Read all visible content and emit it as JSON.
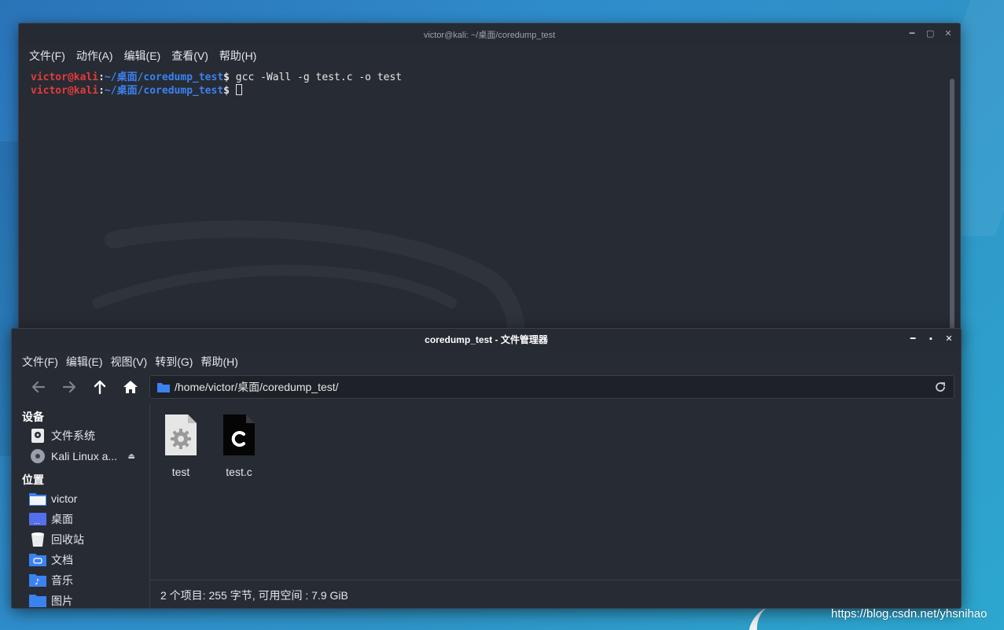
{
  "terminal": {
    "title": "victor@kali: ~/桌面/coredump_test",
    "menu": [
      "文件(F)",
      "动作(A)",
      "编辑(E)",
      "查看(V)",
      "帮助(H)"
    ],
    "lines": [
      {
        "user": "victor@kali",
        "sep": ":",
        "path": "~/桌面/coredump_test",
        "dollar": "$",
        "cmd": " gcc -Wall -g test.c -o test"
      },
      {
        "user": "victor@kali",
        "sep": ":",
        "path": "~/桌面/coredump_test",
        "dollar": "$",
        "cmd": " "
      }
    ]
  },
  "file_manager": {
    "title": "coredump_test - 文件管理器",
    "menu": [
      "文件(F)",
      "编辑(E)",
      "视图(V)",
      "转到(G)",
      "帮助(H)"
    ],
    "address": "/home/victor/桌面/coredump_test/",
    "sidebar": {
      "devices_header": "设备",
      "devices": [
        {
          "label": "文件系统",
          "icon": "drive-icon"
        },
        {
          "label": "Kali Linux a...",
          "icon": "disc-icon"
        }
      ],
      "places_header": "位置",
      "places": [
        {
          "label": "victor",
          "icon": "home-folder-icon"
        },
        {
          "label": "桌面",
          "icon": "desktop-folder-icon"
        },
        {
          "label": "回收站",
          "icon": "trash-icon"
        },
        {
          "label": "文档",
          "icon": "documents-folder-icon"
        },
        {
          "label": "音乐",
          "icon": "music-folder-icon"
        },
        {
          "label": "图片",
          "icon": "pictures-folder-icon"
        }
      ]
    },
    "files": [
      {
        "name": "test",
        "icon": "executable-file-icon"
      },
      {
        "name": "test.c",
        "icon": "c-source-file-icon"
      }
    ],
    "status": "2 个项目: 255 字节, 可用空间 : 7.9 GiB"
  },
  "watermark": "https://blog.csdn.net/yhsnihao",
  "colors": {
    "prompt_user": "#e33b3b",
    "prompt_path": "#3b82f1",
    "window_bg": "#272b33",
    "folder_blue": "#3b82f1"
  }
}
